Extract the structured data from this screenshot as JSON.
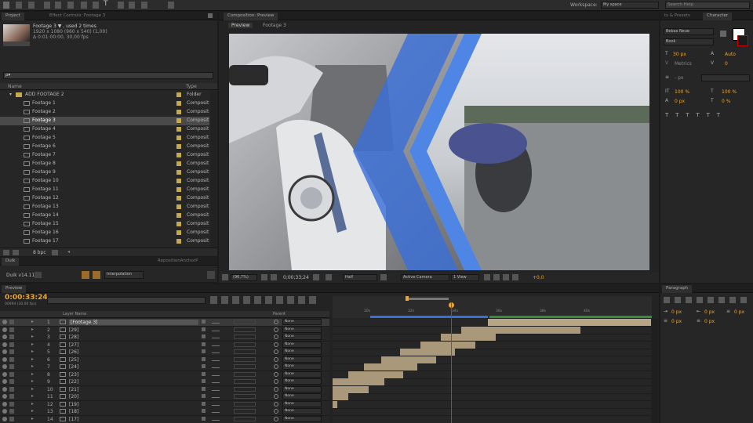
{
  "toolbar": {
    "workspace_label": "Workspace:",
    "workspace_value": "My space",
    "search_placeholder": "Search Help"
  },
  "project": {
    "tab_label": "Project",
    "effect_tab_label": "Effect Controls: Footage 3",
    "thumb_name": "Footage 3 ▼ , used 2 times",
    "thumb_size": "1920 x 1080  (960 x 540) (1,00)",
    "thumb_duration": "Δ 0:01:00:00, 30,00 fps",
    "search_placeholder": "ρ▾",
    "col_name": "Name",
    "col_type": "Type",
    "folder": {
      "name": "ADD FOOTAGE 2",
      "type": "Folder"
    },
    "items": [
      {
        "name": "Footage 1",
        "type": "Composit"
      },
      {
        "name": "Footage 2",
        "type": "Composit"
      },
      {
        "name": "Footage 3",
        "type": "Composit"
      },
      {
        "name": "Footage 4",
        "type": "Composit"
      },
      {
        "name": "Footage 5",
        "type": "Composit"
      },
      {
        "name": "Footage 6",
        "type": "Composit"
      },
      {
        "name": "Footage 7",
        "type": "Composit"
      },
      {
        "name": "Footage 8",
        "type": "Composit"
      },
      {
        "name": "Footage 9",
        "type": "Composit"
      },
      {
        "name": "Footage 10",
        "type": "Composit"
      },
      {
        "name": "Footage 11",
        "type": "Composit"
      },
      {
        "name": "Footage 12",
        "type": "Composit"
      },
      {
        "name": "Footage 13",
        "type": "Composit"
      },
      {
        "name": "Footage 14",
        "type": "Composit"
      },
      {
        "name": "Footage 15",
        "type": "Composit"
      },
      {
        "name": "Footage 16",
        "type": "Composit"
      },
      {
        "name": "Footage 17",
        "type": "Composit"
      }
    ],
    "bit_depth": "8 bpc"
  },
  "duik": {
    "tab_label": "Duik",
    "tab2_label": "RepositionAnchorP",
    "version": "Duik v14.11",
    "mode": "Interpolation"
  },
  "composition": {
    "tab_label": "Composition: Preview",
    "sub_preview": "Preview",
    "sub_footage": "Footage 3",
    "zoom": "(96,7%)",
    "timecode": "0;00;33;24",
    "resolution": "Half",
    "camera": "Active Camera",
    "views": "1 View",
    "exposure": "+0,0"
  },
  "character": {
    "tab_effects": "ts & Presets",
    "tab_char": "Character",
    "font": "Bebas Neue",
    "style": "Book",
    "size": "30 px",
    "leading": "Auto",
    "tracking": "Auto px",
    "kerning": "Metrics",
    "tsume": "0",
    "stroke": "- px",
    "vscale": "100 %",
    "hscale": "100 %",
    "baseline": "0 px",
    "tsume2": "0 %"
  },
  "paragraph": {
    "tab_label": "Paragraph",
    "indent": [
      "0 px",
      "0 px",
      "0 px",
      "0 px",
      "0 px"
    ]
  },
  "timeline": {
    "tab_label": "Preview",
    "current_time": "0:00:33:24",
    "fps_sub": "00994 (30.00 fps)",
    "col_layer": "Layer Name",
    "col_parent": "Parent",
    "ruler": [
      "30s",
      "32s",
      "34s",
      "36s",
      "38s",
      "40s"
    ],
    "layers": [
      {
        "num": "1",
        "name": "[Footage 3]",
        "parent": "None"
      },
      {
        "num": "2",
        "name": "[29]",
        "parent": "None"
      },
      {
        "num": "3",
        "name": "[28]",
        "parent": "None"
      },
      {
        "num": "4",
        "name": "[27]",
        "parent": "None"
      },
      {
        "num": "5",
        "name": "[26]",
        "parent": "None"
      },
      {
        "num": "6",
        "name": "[25]",
        "parent": "None"
      },
      {
        "num": "7",
        "name": "[24]",
        "parent": "None"
      },
      {
        "num": "8",
        "name": "[23]",
        "parent": "None"
      },
      {
        "num": "9",
        "name": "[22]",
        "parent": "None"
      },
      {
        "num": "10",
        "name": "[21]",
        "parent": "None"
      },
      {
        "num": "11",
        "name": "[20]",
        "parent": "None"
      },
      {
        "num": "12",
        "name": "[19]",
        "parent": "None"
      },
      {
        "num": "13",
        "name": "[18]",
        "parent": "None"
      },
      {
        "num": "14",
        "name": "[17]",
        "parent": "None"
      }
    ]
  },
  "colors": {
    "accent_orange": "#e7a53a",
    "playhead": "#d22b2b",
    "layer_bar": "#a9987a",
    "motion_blue": "#3a6fd8"
  }
}
